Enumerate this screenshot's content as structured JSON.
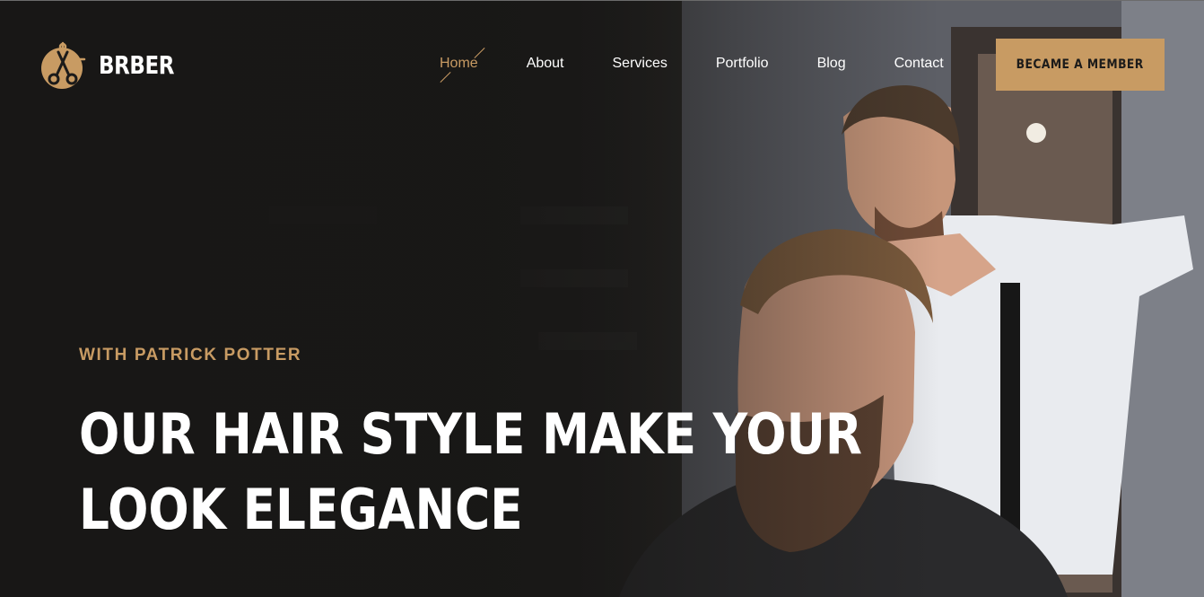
{
  "brand": {
    "name": "BRBER",
    "accent_color": "#c89b63",
    "logo_icon": "scissors-icon"
  },
  "nav": {
    "items": [
      {
        "label": "Home",
        "active": true
      },
      {
        "label": "About",
        "active": false
      },
      {
        "label": "Services",
        "active": false
      },
      {
        "label": "Portfolio",
        "active": false
      },
      {
        "label": "Blog",
        "active": false
      },
      {
        "label": "Contact",
        "active": false
      }
    ]
  },
  "cta": {
    "label": "BECAME A MEMBER"
  },
  "hero": {
    "subtitle": "WITH PATRICK POTTER",
    "headline_line1": "OUR HAIR STYLE MAKE YOUR",
    "headline_line2": "LOOK ELEGANCE"
  }
}
